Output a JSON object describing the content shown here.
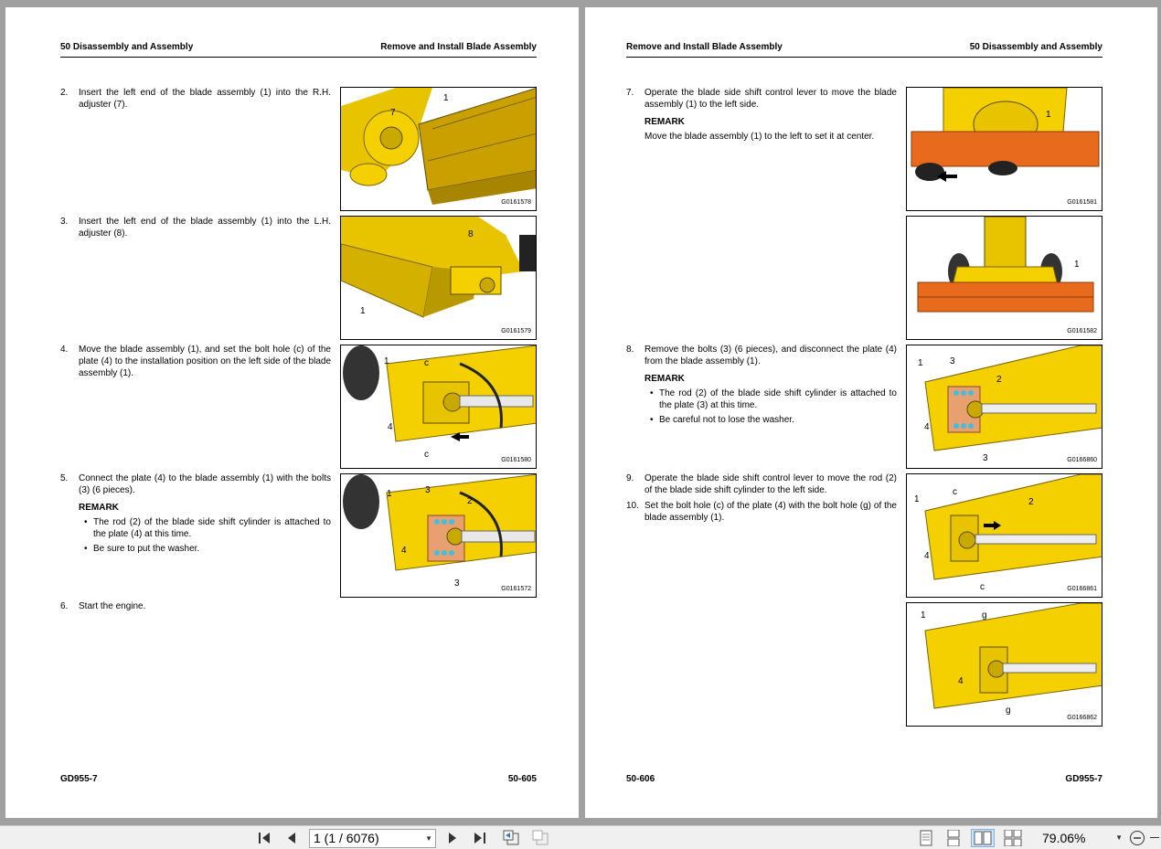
{
  "left_page": {
    "header_left": "50 Disassembly and Assembly",
    "header_right": "Remove and Install Blade Assembly",
    "footer_left": "GD955-7",
    "footer_right": "50-605",
    "steps": [
      {
        "num": "2.",
        "text": "Insert the left end of the blade assembly (1) into the R.H. adjuster (7)."
      },
      {
        "num": "3.",
        "text": "Insert the left end of the blade assembly (1) into the L.H. adjuster (8)."
      },
      {
        "num": "4.",
        "text": "Move the blade assembly (1), and set the bolt hole (c) of the plate (4) to the installation position on the left side of the blade assembly (1)."
      },
      {
        "num": "5.",
        "text": "Connect the plate (4) to the blade assembly (1) with the bolts (3) (6 pieces).",
        "remark": "REMARK",
        "bullets": [
          "The rod (2) of the blade side shift cylinder is attached to the plate (4) at this time.",
          "Be sure to put the washer."
        ]
      },
      {
        "num": "6.",
        "text": "Start the engine."
      }
    ],
    "figures": [
      {
        "code": "G0161578",
        "callouts": [
          "1",
          "7"
        ]
      },
      {
        "code": "G0161579",
        "callouts": [
          "8",
          "1"
        ]
      },
      {
        "code": "G0161580",
        "callouts": [
          "1",
          "c",
          "4",
          "c"
        ]
      },
      {
        "code": "G0161572",
        "callouts": [
          "1",
          "3",
          "2",
          "4",
          "3"
        ]
      }
    ]
  },
  "right_page": {
    "header_left": "Remove and Install Blade Assembly",
    "header_right": "50 Disassembly and Assembly",
    "footer_left": "50-606",
    "footer_right": "GD955-7",
    "steps": [
      {
        "num": "7.",
        "text": "Operate the blade side shift control lever to move the blade assembly (1) to the left side.",
        "remark": "REMARK",
        "remark_text": "Move the blade assembly (1) to the left to set it at center."
      },
      {
        "num": "8.",
        "text": "Remove the bolts (3) (6 pieces), and disconnect the plate (4) from the blade assembly (1).",
        "remark": "REMARK",
        "bullets": [
          "The rod (2) of the blade side shift cylinder is attached to the plate (3) at this time.",
          "Be careful not to lose the washer."
        ]
      },
      {
        "num": "9.",
        "text": "Operate the blade side shift control lever to move the rod (2) of the blade side shift cylinder to the left side."
      },
      {
        "num": "10.",
        "text": "Set the bolt hole (c) of the plate (4) with the bolt hole (g) of the blade assembly (1)."
      }
    ],
    "figures": [
      {
        "code": "G0161581",
        "callouts": [
          "1"
        ]
      },
      {
        "code": "G0161582",
        "callouts": [
          "1"
        ]
      },
      {
        "code": "G0166860",
        "callouts": [
          "1",
          "3",
          "2",
          "4",
          "3"
        ]
      },
      {
        "code": "G0166861",
        "callouts": [
          "1",
          "c",
          "2",
          "4",
          "c"
        ]
      },
      {
        "code": "G0166862",
        "callouts": [
          "1",
          "g",
          "4",
          "g"
        ]
      }
    ]
  },
  "toolbar": {
    "page_indicator": "1 (1 / 6076)",
    "zoom": "79.06%",
    "icons": [
      "first-page-icon",
      "prev-page-icon",
      "next-page-icon",
      "last-page-icon",
      "prev-view-icon",
      "next-view-icon",
      "single-page-view-icon",
      "continuous-view-icon",
      "facing-view-icon",
      "continuous-facing-view-icon",
      "zoom-out-icon"
    ]
  },
  "colors": {
    "machine_yellow": "#f5d000",
    "blade_orange": "#e86a1c",
    "background_gray": "#a0a0a0",
    "toolbar": "#f0f0f0"
  }
}
